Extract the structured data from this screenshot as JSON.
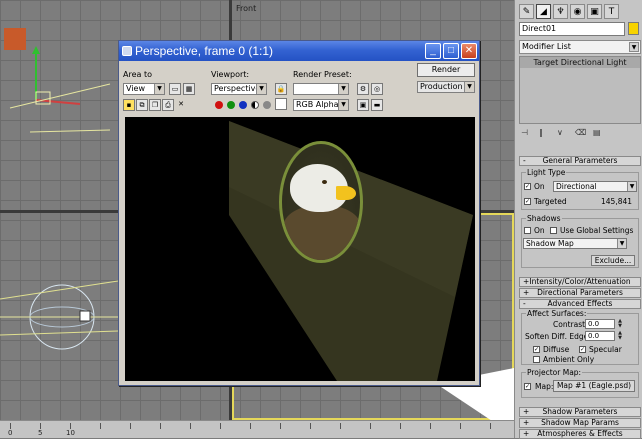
{
  "viewports": {
    "front_label": "Front"
  },
  "render_window": {
    "title": "Perspective, frame 0 (1:1)",
    "area_to_label": "Area to",
    "area_to_value": "View",
    "viewport_label": "Viewport:",
    "viewport_value": "Perspective",
    "render_preset_label": "Render Preset:",
    "render_preset_value": "",
    "render_button": "Render",
    "production_value": "Production",
    "channel_value": "RGB Alpha",
    "dot_colors": [
      "#d01010",
      "#109010",
      "#1030c0"
    ]
  },
  "command_panel": {
    "object_name": "Direct01",
    "swatch_color": "#f7d300",
    "modifier_list": "Modifier List",
    "stack_item": "Target Directional Light",
    "general_parameters": "General Parameters",
    "light_type_group": "Light Type",
    "on_label": "On",
    "light_type_value": "Directional",
    "targeted_label": "Targeted",
    "targeted_distance": "145,841",
    "shadows_group": "Shadows",
    "shadows_on_label": "On",
    "use_global_label": "Use Global Settings",
    "shadow_type": "Shadow Map",
    "exclude_button": "Exclude...",
    "intensity_rollout": "Intensity/Color/Attenuation",
    "directional_rollout": "Directional Parameters",
    "advanced_rollout": "Advanced Effects",
    "affect_surfaces_group": "Affect Surfaces:",
    "contrast_label": "Contrast:",
    "contrast_value": "0.0",
    "soften_label": "Soften Diff. Edge:",
    "soften_value": "0.0",
    "diffuse_label": "Diffuse",
    "specular_label": "Specular",
    "ambient_label": "Ambient Only",
    "projector_group": "Projector Map:",
    "map_label": "Map:",
    "map_button": "Map #1 (Eagle.psd)",
    "shadow_params_rollout": "Shadow Parameters",
    "shadow_map_params_rollout": "Shadow Map Params",
    "atmospheres_rollout": "Atmospheres & Effects"
  },
  "trackbar": {
    "ticks": [
      "0",
      "5",
      "10"
    ]
  }
}
